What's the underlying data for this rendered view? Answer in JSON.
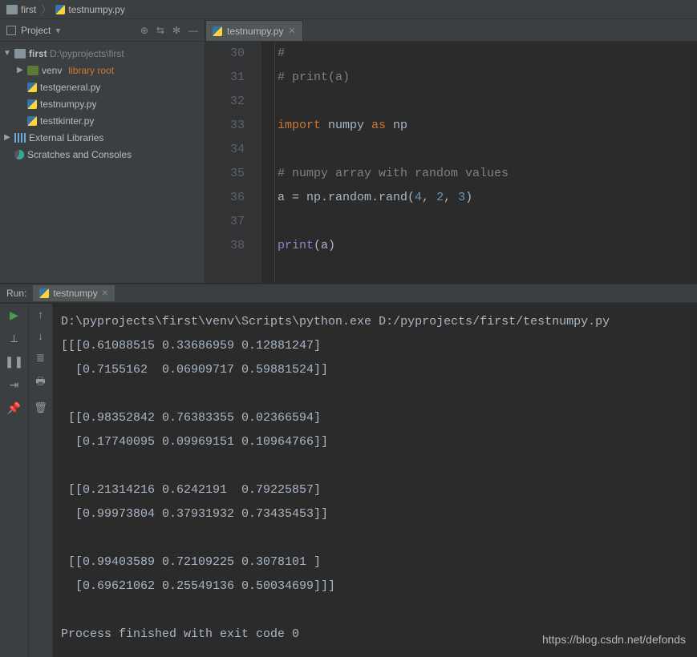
{
  "breadcrumb": {
    "root": "first",
    "file": "testnumpy.py"
  },
  "project": {
    "title": "Project",
    "tree": {
      "root": {
        "name": "first",
        "path": "D:\\pyprojects\\first"
      },
      "venv": {
        "name": "venv",
        "tag": "library root"
      },
      "files": [
        "testgeneral.py",
        "testnumpy.py",
        "testtkinter.py"
      ],
      "external": "External Libraries",
      "scratches": "Scratches and Consoles"
    }
  },
  "editor": {
    "tab": "testnumpy.py",
    "lines": [
      {
        "n": 30,
        "type": "cm",
        "text": "#"
      },
      {
        "n": 31,
        "type": "cm",
        "text": "# print(a)"
      },
      {
        "n": 32,
        "type": "blank",
        "text": ""
      },
      {
        "n": 33,
        "type": "import",
        "kw1": "import",
        "mod": "numpy",
        "kw2": "as",
        "alias": "np"
      },
      {
        "n": 34,
        "type": "blank",
        "text": ""
      },
      {
        "n": 35,
        "type": "cm",
        "text": "# numpy array with random values"
      },
      {
        "n": 36,
        "type": "assign",
        "lhs": "a = np.random.rand",
        "args": [
          "4",
          "2",
          "3"
        ]
      },
      {
        "n": 37,
        "type": "blank",
        "text": ""
      },
      {
        "n": 38,
        "type": "print",
        "fn": "print",
        "arg": "a"
      }
    ]
  },
  "run": {
    "label": "Run:",
    "tab": "testnumpy",
    "output": "D:\\pyprojects\\first\\venv\\Scripts\\python.exe D:/pyprojects/first/testnumpy.py\n[[[0.61088515 0.33686959 0.12881247]\n  [0.7155162  0.06909717 0.59881524]]\n\n [[0.98352842 0.76383355 0.02366594]\n  [0.17740095 0.09969151 0.10964766]]\n\n [[0.21314216 0.6242191  0.79225857]\n  [0.99973804 0.37931932 0.73435453]]\n\n [[0.99403589 0.72109225 0.3078101 ]\n  [0.69621062 0.25549136 0.50034699]]]\n\nProcess finished with exit code 0"
  },
  "watermark": "https://blog.csdn.net/defonds"
}
